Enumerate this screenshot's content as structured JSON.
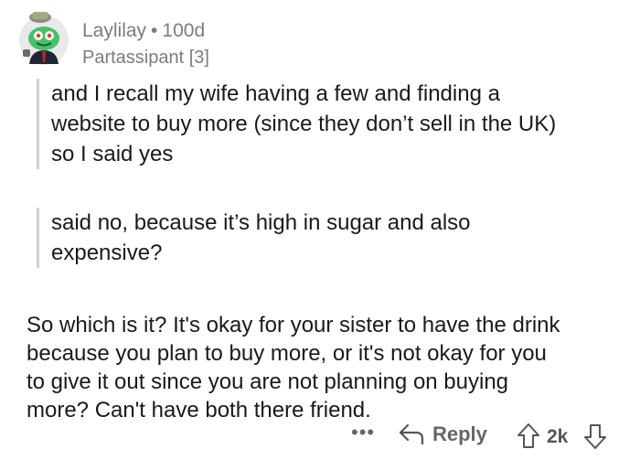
{
  "comment": {
    "author": "Laylilay",
    "separator": "•",
    "age": "100d",
    "flair": "Partassipant [3]",
    "quotes": [
      [
        "and I recall my wife having a few and finding a",
        "website to buy more (since they don’t sell in the UK)",
        "so I said yes"
      ],
      [
        "said no, because it’s high in sugar and also",
        "expensive?"
      ]
    ],
    "body_lines": [
      "So which is it? It's okay for your sister to have the drink",
      "because you plan to buy more, or it's not okay for you",
      "to give it out since you are not planning on buying",
      "more? Can't have both there friend."
    ]
  },
  "actions": {
    "more_label": "•••",
    "reply_label": "Reply",
    "score": "2k"
  },
  "icons": {
    "avatar": "snoo-avatar-icon",
    "reply": "reply-arrow-icon",
    "upvote": "upvote-arrow-icon",
    "downvote": "downvote-arrow-icon"
  }
}
